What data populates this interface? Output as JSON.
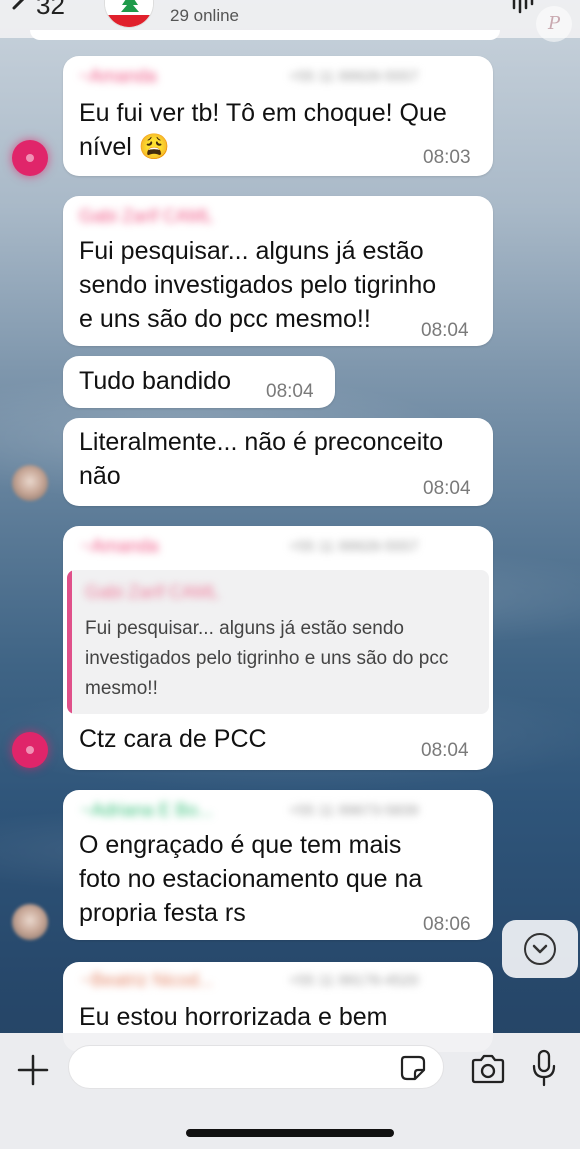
{
  "header": {
    "unread_count": "32",
    "online_status": "29 online"
  },
  "badge": {
    "label": "P"
  },
  "messages": [
    {
      "sender": "~Amanda",
      "phone": "+55 11 99926-5557",
      "text": "Eu fui ver tb! Tô em choque! Que\nnível 😩",
      "time": "08:03"
    },
    {
      "sender": "Gabi Zarif CAML",
      "text": "Fui pesquisar... alguns já estão\nsendo investigados pelo tigrinho\ne uns são do pcc mesmo!!",
      "time": "08:04"
    },
    {
      "text": "Tudo bandido",
      "time": "08:04"
    },
    {
      "text": "Literalmente... não é preconceito\nnão",
      "time": "08:04"
    },
    {
      "sender": "~Amanda",
      "phone": "+55 11 99926-5557",
      "quote_sender": "Gabi Zarif CAML",
      "quote_text": "Fui pesquisar... alguns já estão sendo investigados pelo tigrinho e uns são do pcc mesmo!!",
      "text": "Ctz cara de PCC",
      "time": "08:04"
    },
    {
      "sender": "~Adriana E Bo...",
      "phone": "+55 11 99673-5839",
      "text": "O engraçado é que tem mais\nfoto no estacionamento que na\npropria festa rs",
      "time": "08:06"
    },
    {
      "sender": "~Beatriz Nicod...",
      "phone": "+55 11 99176-4520",
      "text": "Eu estou horrorizada e bem"
    }
  ],
  "icons": {
    "back": "chevron-left-icon",
    "waveform": "audio-waveform-icon",
    "scroll_down": "chevron-down-icon",
    "attach": "plus-icon",
    "sticker": "sticker-icon",
    "camera": "camera-icon",
    "mic": "microphone-icon"
  },
  "colors": {
    "bubble": "#ffffff",
    "avatar_pink": "#e0256a",
    "sender_pink": "#f05a87",
    "sender_green": "#3cc27d",
    "quote_bar": "#e0508a",
    "timestamp": "#7a7a7a"
  }
}
